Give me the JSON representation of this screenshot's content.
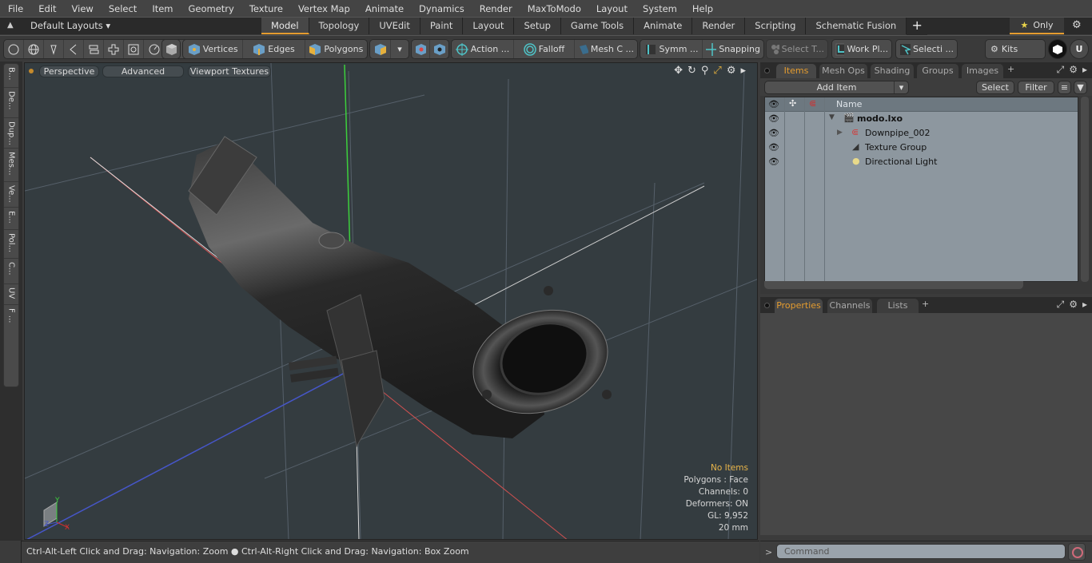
{
  "menu": [
    "File",
    "Edit",
    "View",
    "Select",
    "Item",
    "Geometry",
    "Texture",
    "Vertex Map",
    "Animate",
    "Dynamics",
    "Render",
    "MaxToModo",
    "Layout",
    "System",
    "Help"
  ],
  "layouts": {
    "label": "Default Layouts",
    "only": "Only"
  },
  "layout_tabs": [
    "Model",
    "Topology",
    "UVEdit",
    "Paint",
    "Layout",
    "Setup",
    "Game Tools",
    "Animate",
    "Render",
    "Scripting",
    "Schematic Fusion"
  ],
  "active_layout_tab": "Model",
  "toolbar": {
    "vertices": "Vertices",
    "edges": "Edges",
    "polygons": "Polygons",
    "action": "Action ...",
    "falloff": "Falloff",
    "mesh": "Mesh C ...",
    "symm": "Symm ...",
    "snapping": "Snapping",
    "select_t": "Select T...",
    "workplane": "Work Pl...",
    "selecti": "Selecti ...",
    "kits": "Kits"
  },
  "left_tabs": [
    "B...",
    "De...",
    "Dup...",
    "Mes...",
    "Ve...",
    "E...",
    "Pol...",
    "C...",
    "UV",
    "F ..."
  ],
  "viewport": {
    "view": "Perspective",
    "shading": "Advanced",
    "textures": "Viewport Textures",
    "info": {
      "items": "No Items",
      "polygons": "Polygons : Face",
      "channels": "Channels: 0",
      "deformers": "Deformers: ON",
      "gl": "GL: 9,952",
      "unit": "20 mm"
    }
  },
  "status": "Ctrl-Alt-Left Click and Drag: Navigation: Zoom ● Ctrl-Alt-Right Click and Drag: Navigation: Box Zoom",
  "items_panel": {
    "tabs": [
      "Items",
      "Mesh Ops",
      "Shading",
      "Groups",
      "Images"
    ],
    "add_item": "Add Item",
    "select": "Select",
    "filter": "Filter",
    "column": "Name",
    "tree": [
      {
        "label": "modo.lxo",
        "bold": true
      },
      {
        "label": "Downpipe_002"
      },
      {
        "label": "Texture Group"
      },
      {
        "label": "Directional Light"
      }
    ]
  },
  "props_panel": {
    "tabs": [
      "Properties",
      "Channels",
      "Lists"
    ]
  },
  "command": {
    "placeholder": "Command",
    "prompt": ">"
  }
}
